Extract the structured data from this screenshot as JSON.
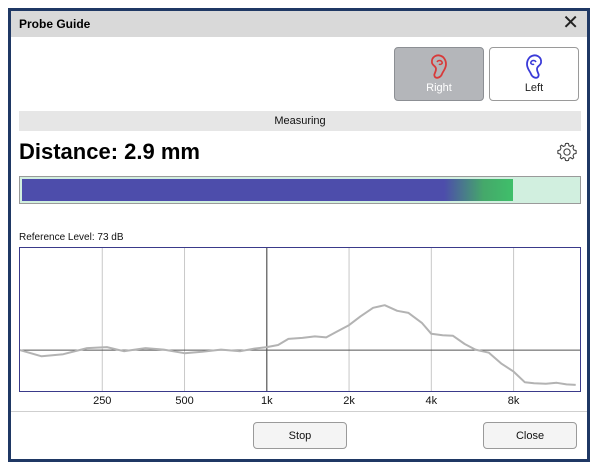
{
  "window": {
    "title": "Probe Guide"
  },
  "ear_selector": {
    "right": {
      "label": "Right",
      "selected": true,
      "color": "#d83a3a"
    },
    "left": {
      "label": "Left",
      "selected": false,
      "color": "#3a3ad8"
    }
  },
  "status": "Measuring",
  "distance": {
    "text": "Distance: 2.9 mm",
    "value": 2.9,
    "unit": "mm"
  },
  "progress": {
    "fraction": 0.88,
    "fill_color": "#4d4dab",
    "track_color": "#d1efdf"
  },
  "reference_level": "Reference Level: 73 dB",
  "chart_data": {
    "type": "line",
    "x_scale": "log",
    "x_ticks": [
      250,
      500,
      1000,
      2000,
      4000,
      8000
    ],
    "x_tick_labels": [
      "250",
      "500",
      "1k",
      "2k",
      "4k",
      "8k"
    ],
    "x_range": [
      125,
      14000
    ],
    "grid": true,
    "series": [
      {
        "color": "#b3b3b3",
        "x": [
          125,
          150,
          180,
          220,
          260,
          300,
          360,
          420,
          500,
          580,
          680,
          800,
          900,
          1000,
          1100,
          1200,
          1350,
          1500,
          1650,
          1800,
          2000,
          2200,
          2450,
          2700,
          3000,
          3300,
          3700,
          4000,
          4400,
          4800,
          5300,
          5800,
          6500,
          7200,
          8000,
          8800,
          9500,
          10500,
          11500,
          12500,
          13500
        ],
        "y": [
          0,
          -1.2,
          -0.8,
          0.4,
          0.6,
          -0.2,
          0.4,
          0.1,
          -0.6,
          -0.3,
          0.1,
          -0.2,
          0.3,
          0.6,
          1,
          2.2,
          2.4,
          2.7,
          2.5,
          3.6,
          4.9,
          6.6,
          8.3,
          8.8,
          7.7,
          7.3,
          5.3,
          3.2,
          2.9,
          2.8,
          1.2,
          0.1,
          -0.5,
          -2.6,
          -4.2,
          -6.3,
          -6.5,
          -6.6,
          -6.4,
          -6.7,
          -6.8
        ]
      }
    ],
    "reference_line_y": 0,
    "highlight_x": 1000
  },
  "buttons": {
    "stop": "Stop",
    "close": "Close"
  }
}
